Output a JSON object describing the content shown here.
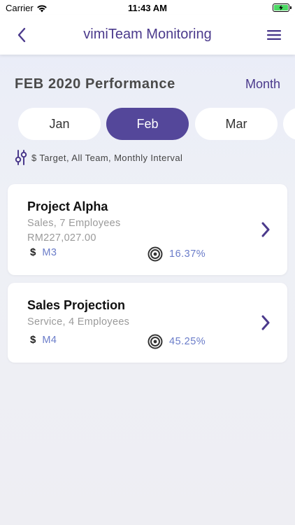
{
  "status": {
    "carrier": "Carrier",
    "time": "11:43 AM",
    "battery_color": "#4cd964"
  },
  "nav": {
    "title": "vimiTeam Monitoring",
    "back_icon": "chevron-left-icon",
    "menu_icon": "hamburger-menu-icon"
  },
  "header": {
    "title": "FEB 2020 Performance",
    "period_toggle": "Month"
  },
  "months": [
    {
      "label": "Jan",
      "active": false
    },
    {
      "label": "Feb",
      "active": true
    },
    {
      "label": "Mar",
      "active": false
    },
    {
      "label": "",
      "active": false
    }
  ],
  "filter": {
    "icon": "filter-sliders-icon",
    "text": "$ Target, All Team, Monthly Interval"
  },
  "projects": [
    {
      "name": "Project Alpha",
      "subtitle": "Sales, 7 Employees",
      "amount": "RM227,027.00",
      "target": "M3",
      "progress": "16.37%"
    },
    {
      "name": "Sales Projection",
      "subtitle": "Service, 4 Employees",
      "target": "M4",
      "progress": "45.25%"
    }
  ],
  "colors": {
    "accent": "#54479a",
    "nav_title": "#4b3a8c",
    "metric_value": "#6a7cc9"
  }
}
